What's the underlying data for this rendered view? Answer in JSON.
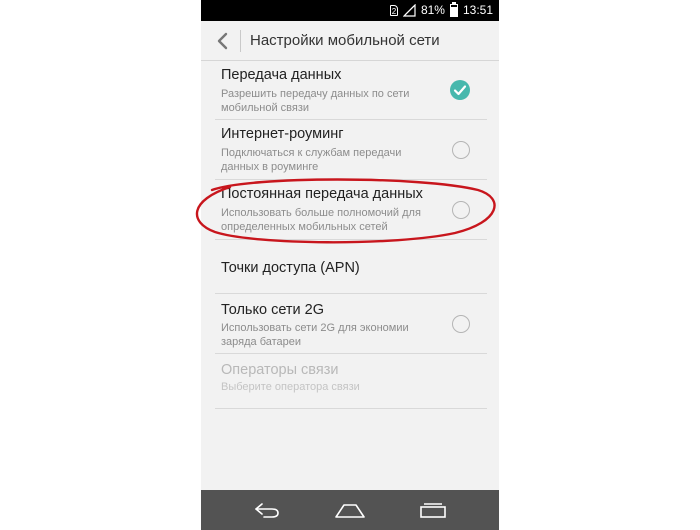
{
  "status_bar": {
    "sim_label": "2",
    "battery_percent": "81%",
    "battery_level": 0.81,
    "time": "13:51"
  },
  "header": {
    "title": "Настройки мобильной сети"
  },
  "settings": [
    {
      "title": "Передача данных",
      "summary": "Разрешить передачу данных по сети мобильной связи",
      "control": "checkbox",
      "checked": true,
      "enabled": true
    },
    {
      "title": "Интернет-роуминг",
      "summary": "Подключаться к службам передачи данных в роуминге",
      "control": "checkbox",
      "checked": false,
      "enabled": true
    },
    {
      "title": "Постоянная передача данных",
      "summary": "Использовать больше полномочий для определенных мобильных сетей",
      "control": "checkbox",
      "checked": false,
      "enabled": true,
      "highlighted": true
    },
    {
      "title": "Точки доступа (APN)",
      "summary": "",
      "control": "none",
      "enabled": true
    },
    {
      "title": "Только сети 2G",
      "summary": "Использовать сети 2G для экономии заряда батареи",
      "control": "checkbox",
      "checked": false,
      "enabled": true
    },
    {
      "title": "Операторы связи",
      "summary": "Выберите оператора связи",
      "control": "none",
      "enabled": false
    }
  ],
  "colors": {
    "accent": "#47b8ad",
    "highlight_ellipse": "#c8161d",
    "nav_bar": "#535353"
  },
  "icons": {
    "back": "chevron-left-icon",
    "nav_back": "back-arrow-icon",
    "nav_home": "home-icon",
    "nav_recent": "recent-apps-icon"
  }
}
